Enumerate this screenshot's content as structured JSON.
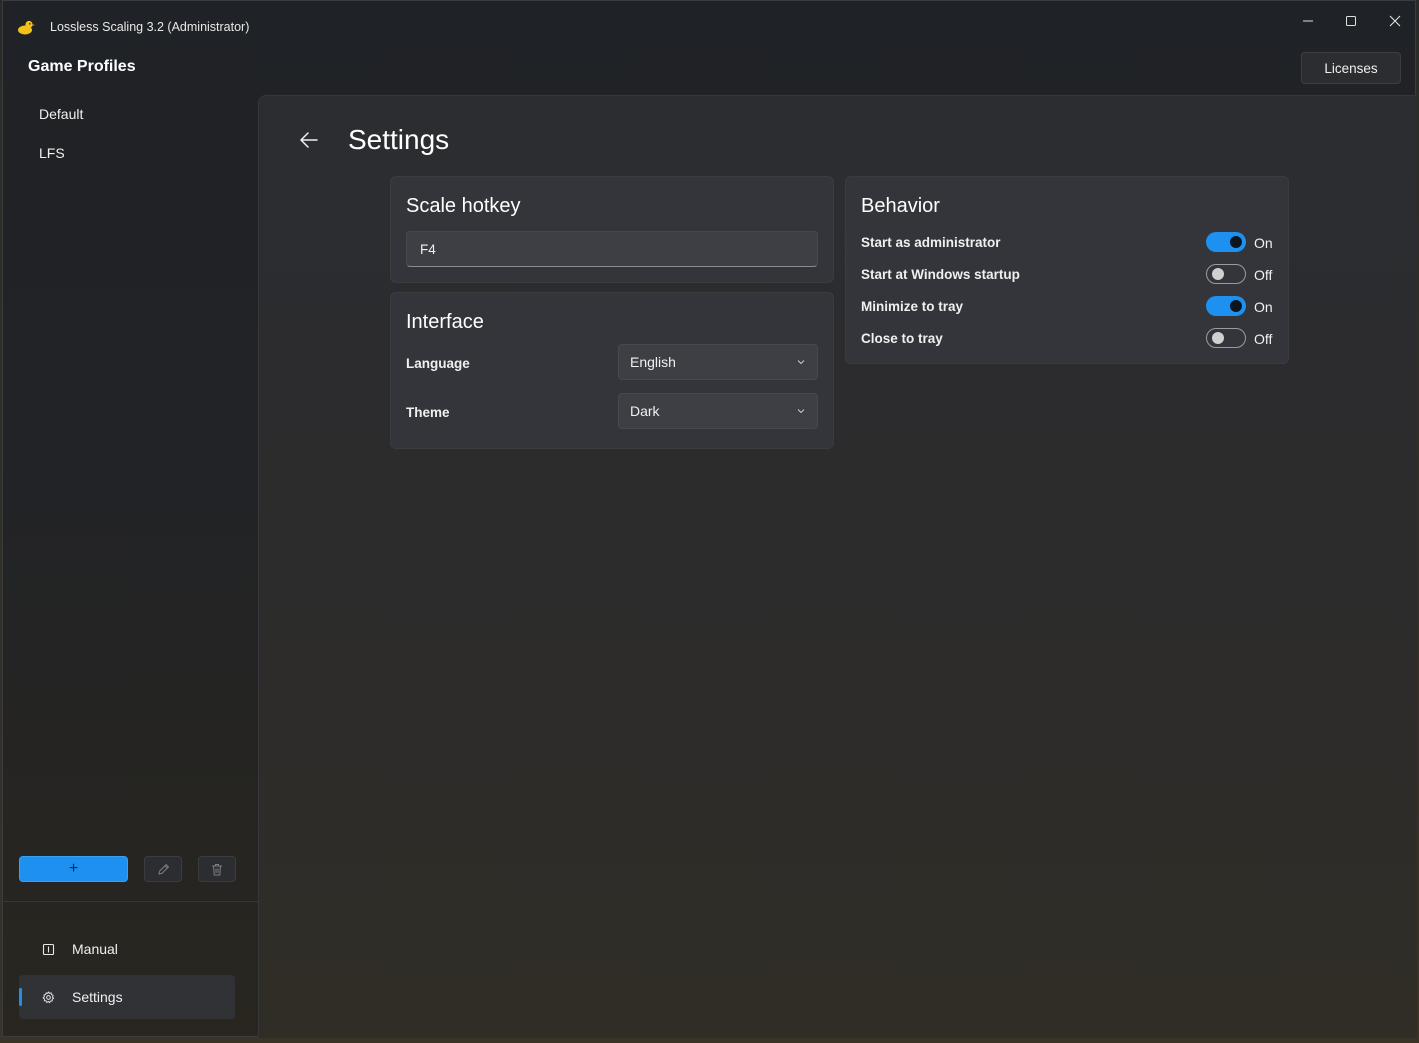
{
  "window": {
    "title": "Lossless Scaling 3.2 (Administrator)",
    "licenses_label": "Licenses"
  },
  "sidebar": {
    "title": "Game Profiles",
    "profiles": [
      {
        "label": "Default"
      },
      {
        "label": "LFS"
      }
    ],
    "add_label": "+",
    "nav": [
      {
        "label": "Manual",
        "icon": "book-icon"
      },
      {
        "label": "Settings",
        "icon": "gear-icon",
        "selected": true
      }
    ]
  },
  "settings": {
    "title": "Settings",
    "scale_hotkey": {
      "title": "Scale hotkey",
      "value": "F4"
    },
    "interface": {
      "title": "Interface",
      "language_label": "Language",
      "language_value": "English",
      "theme_label": "Theme",
      "theme_value": "Dark"
    },
    "behavior": {
      "title": "Behavior",
      "items": [
        {
          "label": "Start as administrator",
          "state": "On"
        },
        {
          "label": "Start at Windows startup",
          "state": "Off"
        },
        {
          "label": "Minimize to tray",
          "state": "On"
        },
        {
          "label": "Close to tray",
          "state": "Off"
        }
      ]
    }
  },
  "colors": {
    "accent": "#1e90f0",
    "card": "#33353a",
    "window": "#222326"
  }
}
